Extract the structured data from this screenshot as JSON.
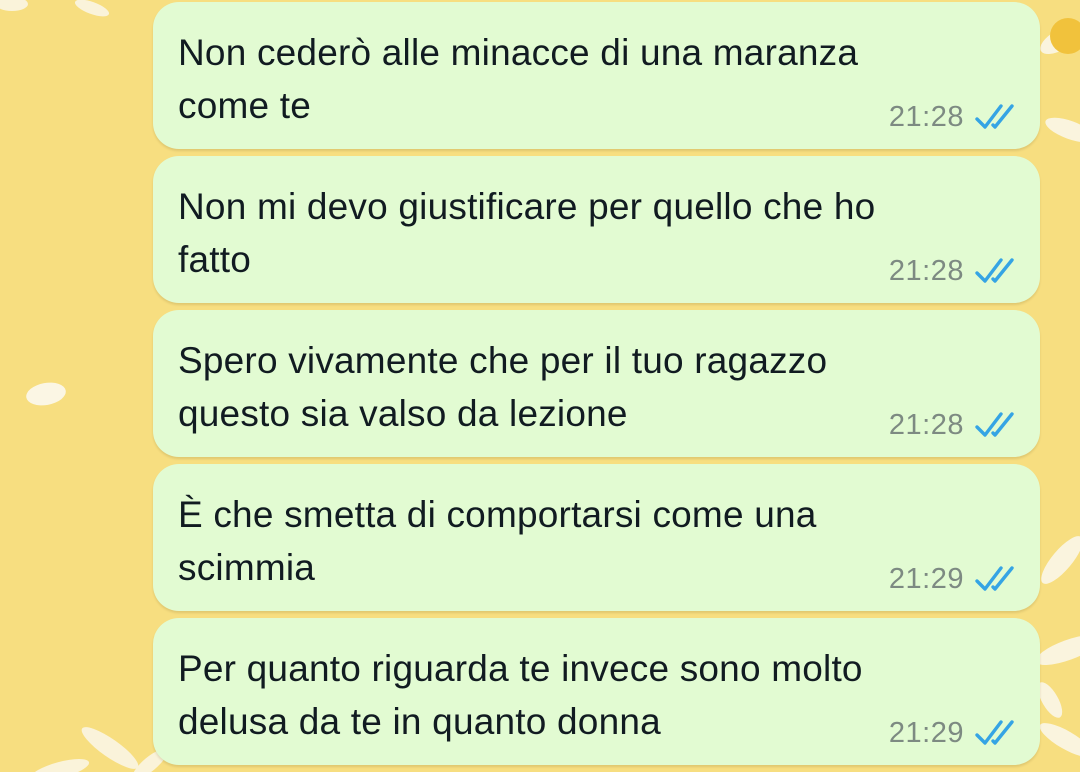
{
  "theme": {
    "wallpaper_color": "#f7de80",
    "bubble_color": "#e2fbd2",
    "text_color": "#111b21",
    "time_color": "#7d8a82",
    "read_tick_color": "#35a4e4"
  },
  "messages": [
    {
      "text": "Non cederò alle minacce di una maranza\ncome te",
      "time": "21:28",
      "status_icon": "double-check-read-icon"
    },
    {
      "text": "Non mi devo giustificare per quello che ho\nfatto",
      "time": "21:28",
      "status_icon": "double-check-read-icon"
    },
    {
      "text": "Spero vivamente che per il tuo ragazzo\nquesto sia valso da lezione",
      "time": "21:28",
      "status_icon": "double-check-read-icon"
    },
    {
      "text": "È che smetta di comportarsi come una\nscimmia",
      "time": "21:29",
      "status_icon": "double-check-read-icon"
    },
    {
      "text": "Per quanto riguarda te invece sono molto\ndelusa da te in quanto donna",
      "time": "21:29",
      "status_icon": "double-check-read-icon"
    }
  ]
}
